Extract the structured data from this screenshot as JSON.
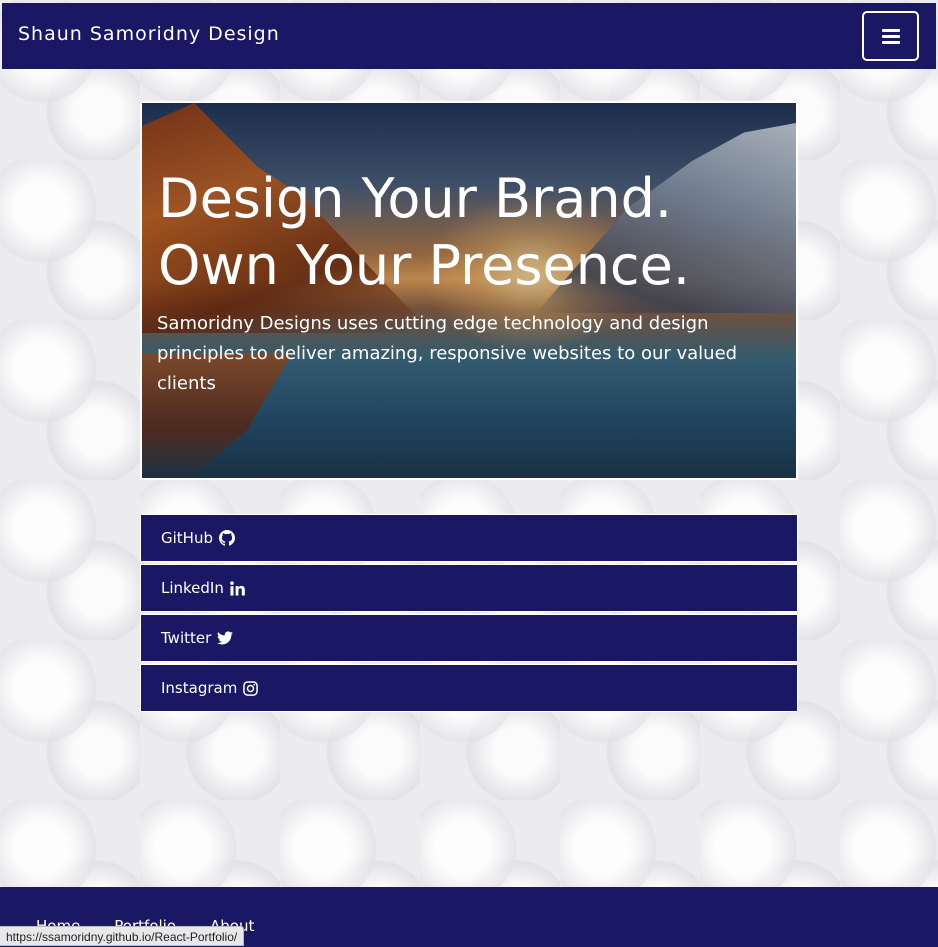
{
  "navbar": {
    "brand": "Shaun Samoridny Design",
    "toggle_icon": "hamburger-menu-icon"
  },
  "hero": {
    "title_line1": "Design Your Brand.",
    "title_line2": "Own Your Presence.",
    "subtitle": "Samoridny Designs uses cutting edge technology and design principles to deliver amazing, responsive websites to our valued clients"
  },
  "social_links": [
    {
      "label": "GitHub",
      "icon": "github-icon"
    },
    {
      "label": "LinkedIn",
      "icon": "linkedin-icon"
    },
    {
      "label": "Twitter",
      "icon": "twitter-icon"
    },
    {
      "label": "Instagram",
      "icon": "instagram-icon"
    }
  ],
  "footer": {
    "nav": [
      "Home",
      "Portfolio",
      "About"
    ]
  },
  "status_bar": {
    "url": "https://ssamoridny.github.io/React-Portfolio/"
  },
  "colors": {
    "primary": "#1a1864",
    "text_light": "#ffffff",
    "background": "#ececef"
  }
}
